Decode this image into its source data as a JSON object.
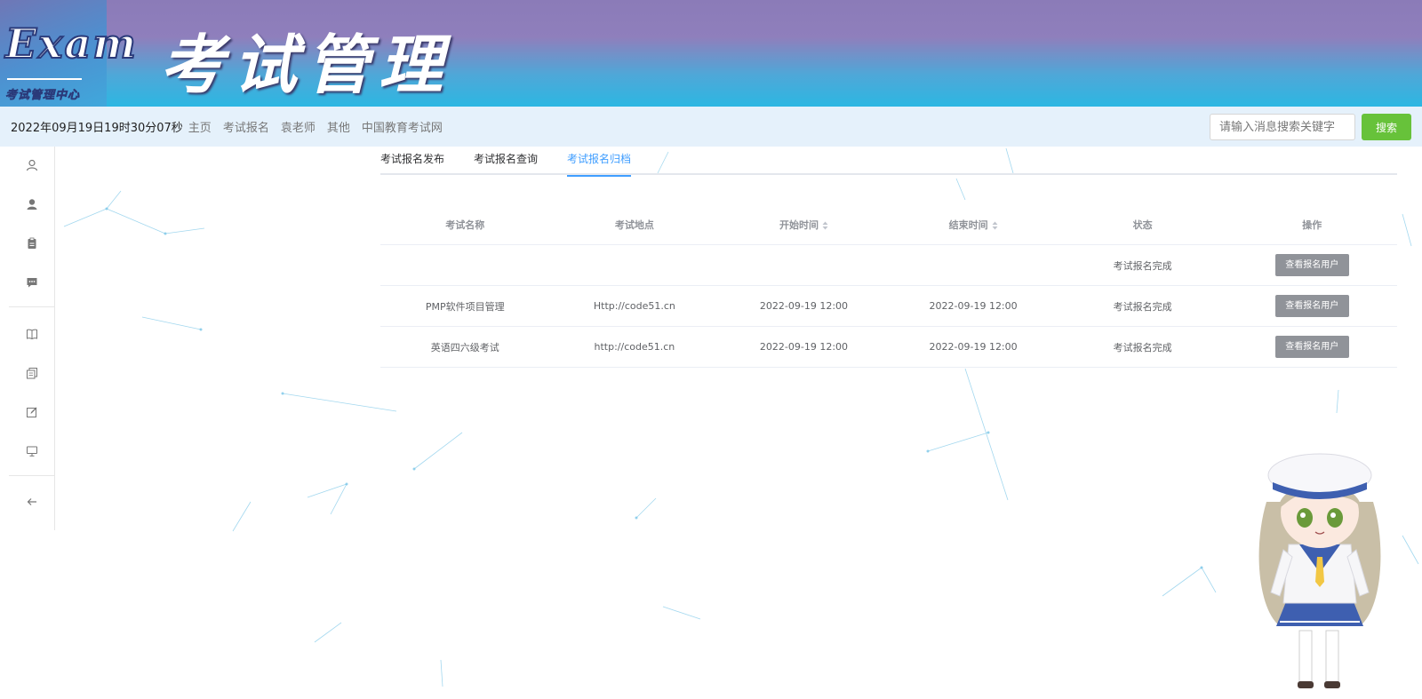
{
  "header": {
    "logo_text": "Exam",
    "logo_subtitle": "考试管理中心",
    "title": "考试管理"
  },
  "navbar": {
    "clock": "2022年09月19日19时30分07秒",
    "links": [
      "主页",
      "考试报名",
      "袁老师",
      "其他",
      "中国教育考试网"
    ],
    "search_placeholder": "请输入消息搜索关键字",
    "search_button": "搜索"
  },
  "sidebar": {
    "icons": [
      "user-outline-icon",
      "user-filled-icon",
      "clipboard-icon",
      "chat-icon",
      "book-icon",
      "documents-icon",
      "edit-icon",
      "monitor-icon",
      "back-arrow-icon"
    ]
  },
  "tabs": {
    "items": [
      "考试报名发布",
      "考试报名查询",
      "考试报名归档"
    ],
    "active_index": 2
  },
  "table": {
    "columns": [
      "考试名称",
      "考试地点",
      "开始时间",
      "结束时间",
      "状态",
      "操作"
    ],
    "sortable": [
      false,
      false,
      true,
      true,
      false,
      false
    ],
    "rows": [
      {
        "name": "",
        "location": "",
        "start": "",
        "end": "",
        "status": "考试报名完成",
        "action": "查看报名用户"
      },
      {
        "name": "PMP软件项目管理",
        "location": "Http://code51.cn",
        "start": "2022-09-19 12:00",
        "end": "2022-09-19 12:00",
        "status": "考试报名完成",
        "action": "查看报名用户"
      },
      {
        "name": "英语四六级考试",
        "location": "http://code51.cn",
        "start": "2022-09-19 12:00",
        "end": "2022-09-19 12:00",
        "status": "考试报名完成",
        "action": "查看报名用户"
      }
    ]
  },
  "colors": {
    "accent": "#409eff",
    "search_button": "#67c23a",
    "action_button": "#909399",
    "nav_background": "#e5f1fb"
  }
}
